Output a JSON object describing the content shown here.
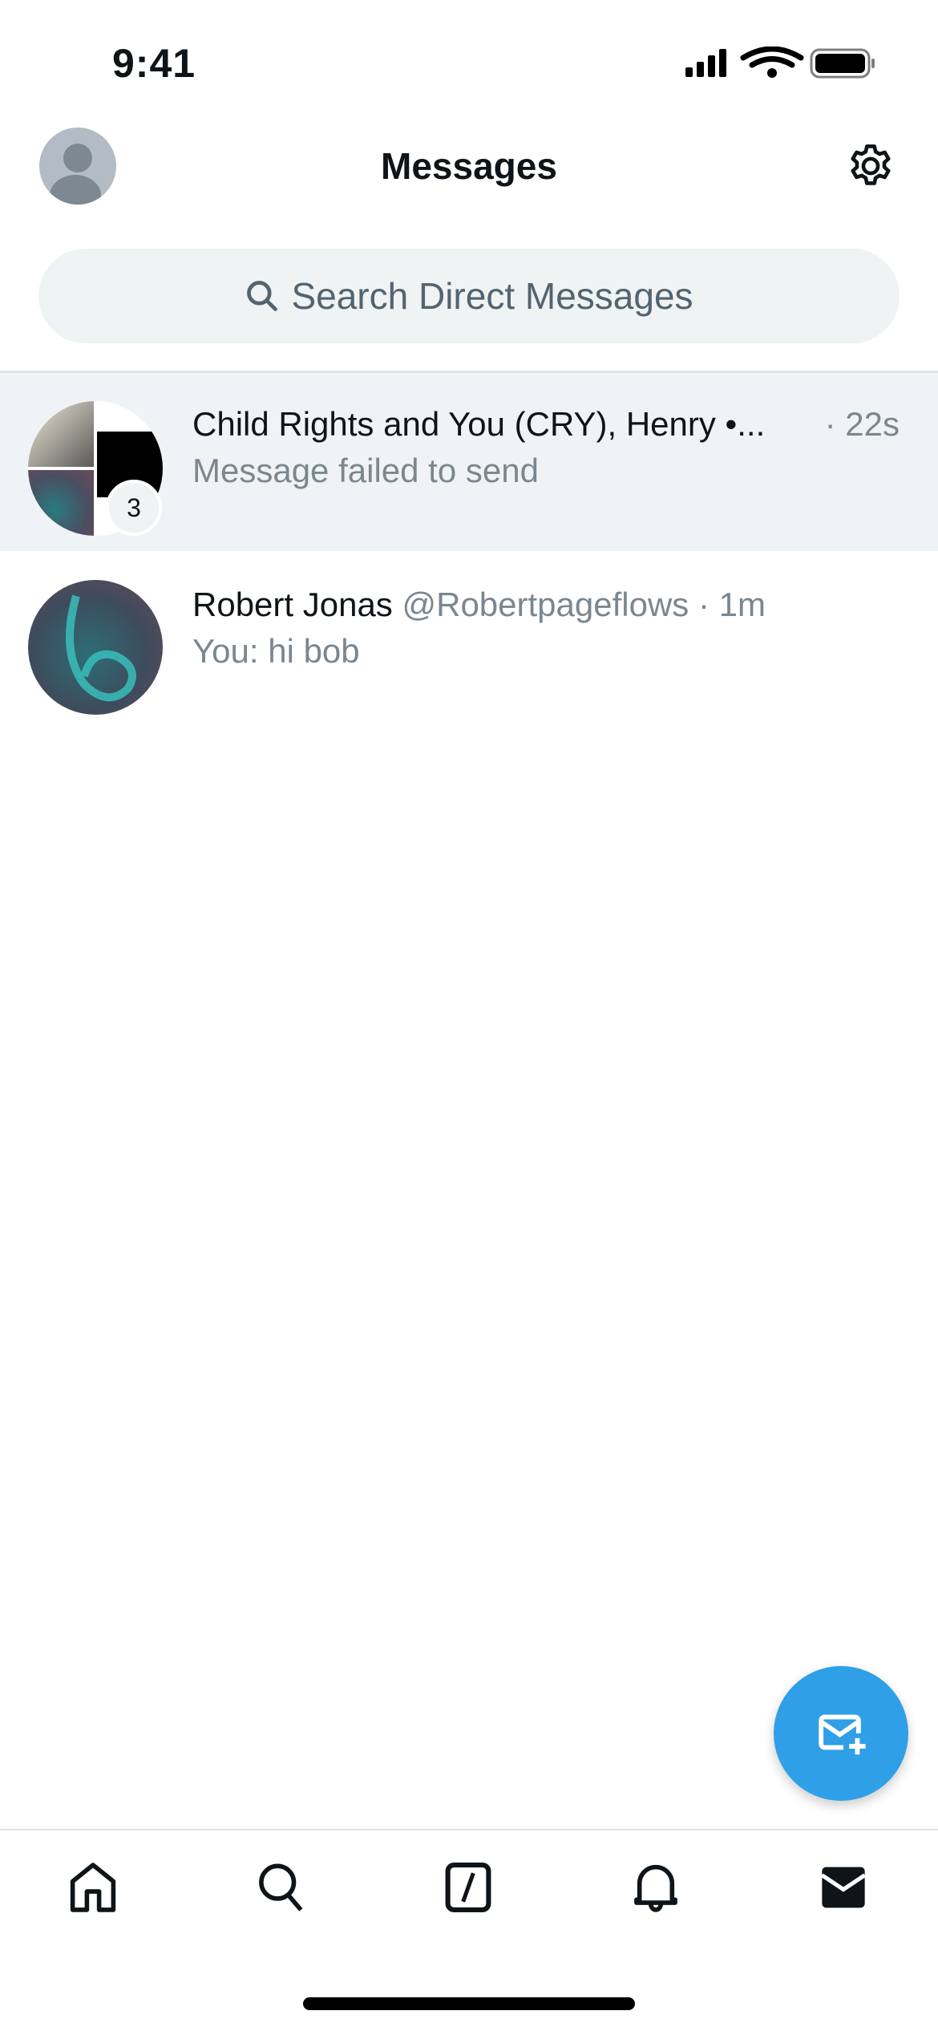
{
  "status_bar": {
    "time": "9:41"
  },
  "header": {
    "title": "Messages",
    "avatar_icon": "profile-avatar",
    "settings_icon": "gear-icon"
  },
  "search": {
    "placeholder": "Search Direct Messages"
  },
  "conversations": [
    {
      "name": "Child Rights and You (CRY), Henry •...",
      "handle": "",
      "time": "· 22s",
      "preview": "Message failed to send",
      "member_badge": "3",
      "selected": true
    },
    {
      "name": "Robert Jonas",
      "handle": "@Robertpageflows",
      "time": "· 1m",
      "preview": "You: hi bob",
      "selected": false
    }
  ],
  "fab": {
    "icon": "new-message-icon"
  },
  "tabbar": {
    "items": [
      "home",
      "search",
      "communities",
      "notifications",
      "messages"
    ],
    "active": "messages"
  },
  "colors": {
    "accent": "#2f9fe8",
    "selected_row": "#f0f3f6",
    "muted_text": "#7a8791"
  }
}
